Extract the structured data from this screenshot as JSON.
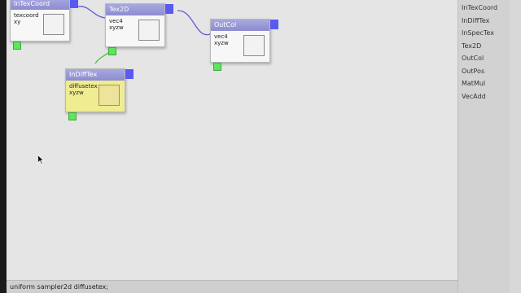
{
  "nodes": {
    "in_tex_coord": {
      "title": "InTexCoord",
      "lines": [
        "texcoord",
        "xy"
      ]
    },
    "tex2d": {
      "title": "Tex2D",
      "lines": [
        "vec4",
        "xyzw"
      ]
    },
    "out_col": {
      "title": "OutCol",
      "lines": [
        "vec4",
        "xyzw"
      ]
    },
    "in_diff_tex": {
      "title": "InDiffTex",
      "lines": [
        "diffusetex",
        "xyzw"
      ]
    }
  },
  "sidebar": {
    "items": [
      {
        "label": "InTexCoord"
      },
      {
        "label": "InDiffTex"
      },
      {
        "label": "InSpecTex"
      },
      {
        "label": "Tex2D"
      },
      {
        "label": "OutCol"
      },
      {
        "label": "OutPos"
      },
      {
        "label": "MatMul"
      },
      {
        "label": "VecAdd"
      }
    ]
  },
  "status": {
    "text": "uniform sampler2d diffusetex;"
  },
  "colors": {
    "node_header": "#9c9cdc",
    "output_port": "#5a5af0",
    "input_port": "#5de55d",
    "highlight_node": "#f0ec92",
    "canvas": "#e5e5e5",
    "wire_blue": "#5a5ad8",
    "wire_green": "#4dbd4d"
  },
  "icons": {
    "cursor": "arrow-cursor-icon"
  }
}
